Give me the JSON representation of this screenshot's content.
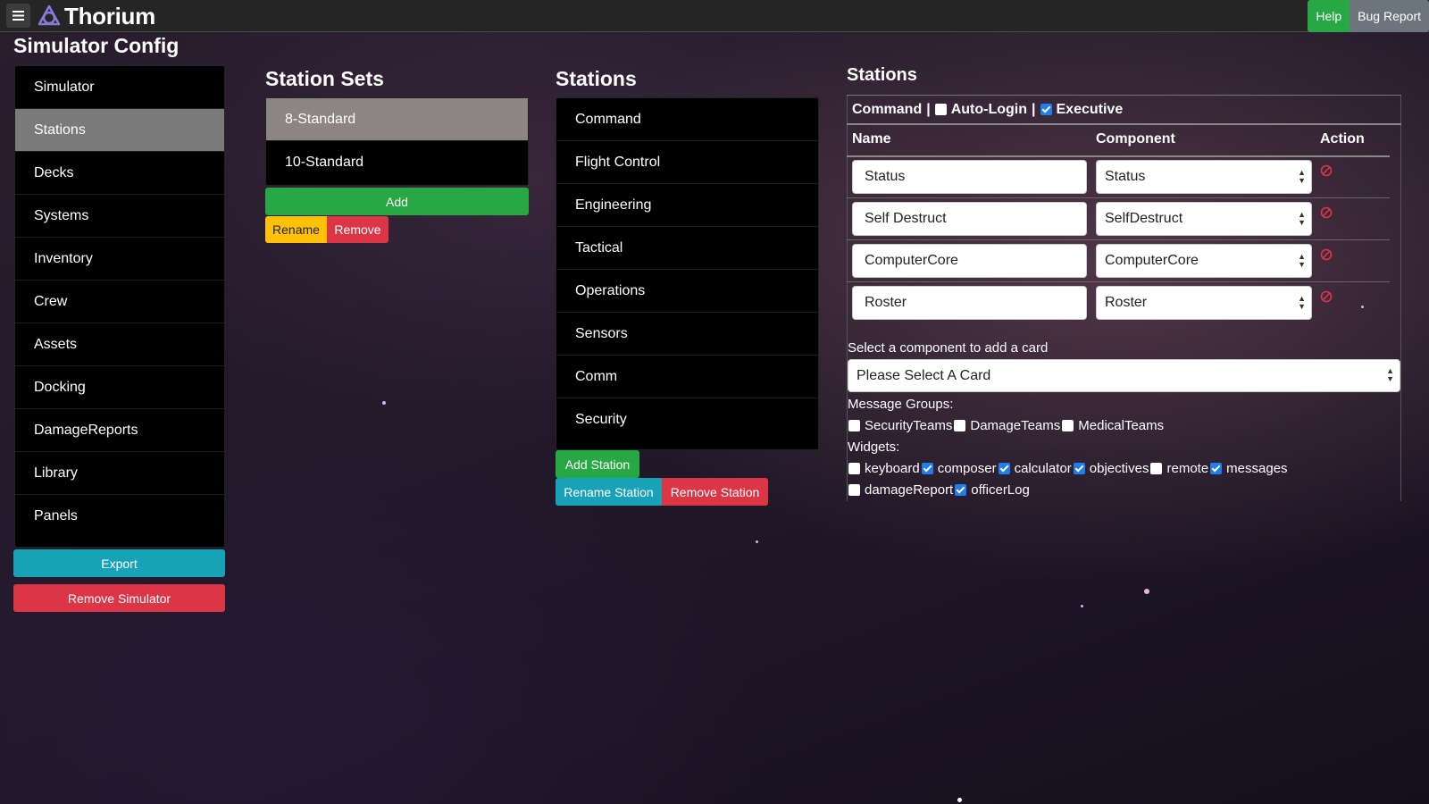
{
  "navbar": {
    "brand": "Thorium",
    "help": "Help",
    "bug_report": "Bug Report"
  },
  "page_title": "Simulator Config",
  "sidebar": {
    "items": [
      {
        "label": "Simulator"
      },
      {
        "label": "Stations",
        "active": true
      },
      {
        "label": "Decks"
      },
      {
        "label": "Systems"
      },
      {
        "label": "Inventory"
      },
      {
        "label": "Crew"
      },
      {
        "label": "Assets"
      },
      {
        "label": "Docking"
      },
      {
        "label": "DamageReports"
      },
      {
        "label": "Library"
      },
      {
        "label": "Panels"
      }
    ],
    "export": "Export",
    "remove_simulator": "Remove Simulator"
  },
  "station_sets": {
    "title": "Station Sets",
    "items": [
      {
        "label": "8-Standard",
        "active": true
      },
      {
        "label": "10-Standard"
      }
    ],
    "add": "Add",
    "rename": "Rename",
    "remove": "Remove"
  },
  "stations": {
    "title": "Stations",
    "items": [
      {
        "label": "Command"
      },
      {
        "label": "Flight Control"
      },
      {
        "label": "Engineering"
      },
      {
        "label": "Tactical"
      },
      {
        "label": "Operations"
      },
      {
        "label": "Sensors"
      },
      {
        "label": "Comm"
      },
      {
        "label": "Security"
      }
    ],
    "add_station": "Add Station",
    "rename_station": "Rename Station",
    "remove_station": "Remove Station"
  },
  "station_detail": {
    "title": "Stations",
    "station_name": "Command",
    "separator": "|",
    "auto_login": {
      "label": "Auto-Login",
      "checked": false
    },
    "executive": {
      "label": "Executive",
      "checked": true
    },
    "columns": {
      "name": "Name",
      "component": "Component",
      "action": "Action"
    },
    "cards": [
      {
        "name": "Status",
        "component": "Status"
      },
      {
        "name": "Self Destruct",
        "component": "SelfDestruct"
      },
      {
        "name": "ComputerCore",
        "component": "ComputerCore"
      },
      {
        "name": "Roster",
        "component": "Roster"
      }
    ],
    "add_card_label": "Select a component to add a card",
    "add_card_placeholder": "Please Select A Card",
    "message_groups_label": "Message Groups:",
    "message_groups": [
      {
        "label": "SecurityTeams",
        "checked": false
      },
      {
        "label": "DamageTeams",
        "checked": false
      },
      {
        "label": "MedicalTeams",
        "checked": false
      }
    ],
    "widgets_label": "Widgets:",
    "widgets_row1": [
      {
        "label": "keyboard",
        "checked": false
      },
      {
        "label": "composer",
        "checked": true
      },
      {
        "label": "calculator",
        "checked": true
      },
      {
        "label": "objectives",
        "checked": true
      },
      {
        "label": "remote",
        "checked": false
      },
      {
        "label": "messages",
        "checked": true
      }
    ],
    "widgets_row2": [
      {
        "label": "damageReport",
        "checked": false
      },
      {
        "label": "officerLog",
        "checked": true
      }
    ]
  },
  "colors": {
    "success": "#28a745",
    "danger": "#dc3545",
    "info": "#17a2b8",
    "warning": "#ffc107",
    "checkbox_checked": "#1e7df0"
  }
}
